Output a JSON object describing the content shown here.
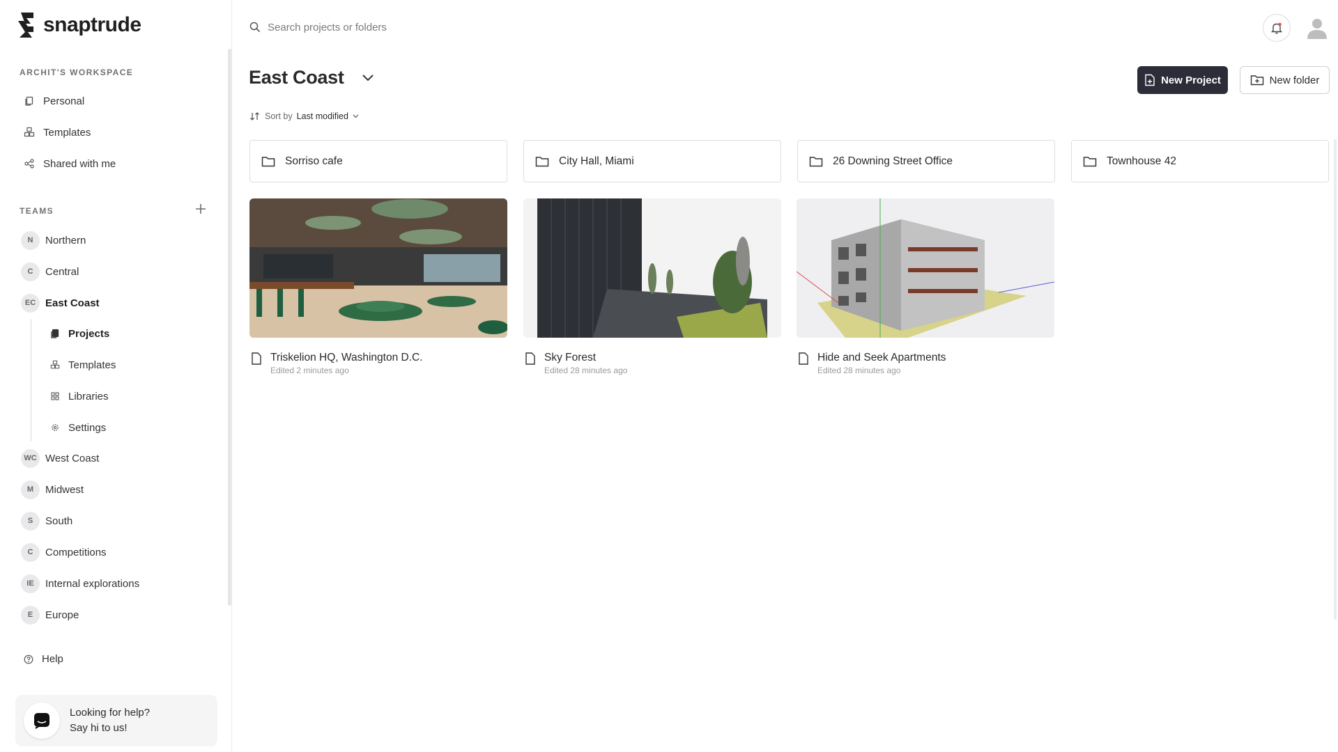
{
  "app": {
    "name": "snaptrude"
  },
  "sidebar": {
    "workspace_title": "ARCHIT'S WORKSPACE",
    "workspace_items": [
      {
        "label": "Personal",
        "icon": "file-stack-icon"
      },
      {
        "label": "Templates",
        "icon": "cubes-icon"
      },
      {
        "label": "Shared with me",
        "icon": "share-icon"
      }
    ],
    "teams_title": "TEAMS",
    "teams": [
      {
        "initials": "N",
        "label": "Northern"
      },
      {
        "initials": "C",
        "label": "Central"
      },
      {
        "initials": "EC",
        "label": "East Coast"
      },
      {
        "initials": "WC",
        "label": "West Coast"
      },
      {
        "initials": "M",
        "label": "Midwest"
      },
      {
        "initials": "S",
        "label": "South"
      },
      {
        "initials": "C",
        "label": "Competitions"
      },
      {
        "initials": "IE",
        "label": "Internal explorations"
      },
      {
        "initials": "E",
        "label": "Europe"
      }
    ],
    "active_team_sub": [
      {
        "label": "Projects",
        "icon": "file-stack-icon"
      },
      {
        "label": "Templates",
        "icon": "cubes-icon"
      },
      {
        "label": "Libraries",
        "icon": "grid-icon"
      },
      {
        "label": "Settings",
        "icon": "gear-icon"
      }
    ],
    "help_label": "Help",
    "chat": {
      "line1": "Looking for help?",
      "line2": "Say hi to us!"
    }
  },
  "search": {
    "placeholder": "Search projects or folders"
  },
  "header": {
    "title": "East Coast",
    "new_project_label": "New Project",
    "new_folder_label": "New folder",
    "sort_prefix": "Sort by",
    "sort_value": "Last modified"
  },
  "folders": [
    {
      "name": "Sorriso cafe"
    },
    {
      "name": "City Hall, Miami"
    },
    {
      "name": "26 Downing Street Office"
    },
    {
      "name": "Townhouse 42"
    }
  ],
  "projects": [
    {
      "name": "Triskelion HQ, Washington D.C.",
      "edited": "Edited 2 minutes ago"
    },
    {
      "name": "Sky Forest",
      "edited": "Edited 28 minutes ago"
    },
    {
      "name": "Hide and Seek Apartments",
      "edited": "Edited 28 minutes ago"
    }
  ],
  "colors": {
    "primary_button": "#2d2d3a",
    "accent_green": "#1f5f3f"
  }
}
